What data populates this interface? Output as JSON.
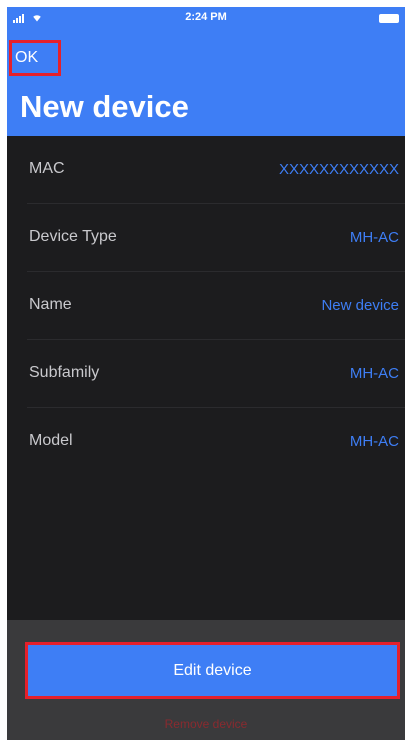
{
  "status_bar": {
    "time": "2:24 PM",
    "signal_icon": "signal-icon",
    "wifi_icon": "wifi-icon",
    "battery_icon": "battery-icon"
  },
  "header": {
    "ok_label": "OK",
    "title": "New device"
  },
  "details": [
    {
      "label": "MAC",
      "value": "XXXXXXXXXXXX"
    },
    {
      "label": "Device Type",
      "value": "MH-AC"
    },
    {
      "label": "Name",
      "value": "New device"
    },
    {
      "label": "Subfamily",
      "value": "MH-AC"
    },
    {
      "label": "Model",
      "value": "MH-AC"
    }
  ],
  "actions": {
    "edit_label": "Edit device",
    "remove_label": "Remove device"
  },
  "colors": {
    "accent": "#3e7ef5",
    "background": "#1c1c1e",
    "footer": "#3a3a3c",
    "highlight": "#e5202b",
    "destructive": "#8a2a2f"
  }
}
